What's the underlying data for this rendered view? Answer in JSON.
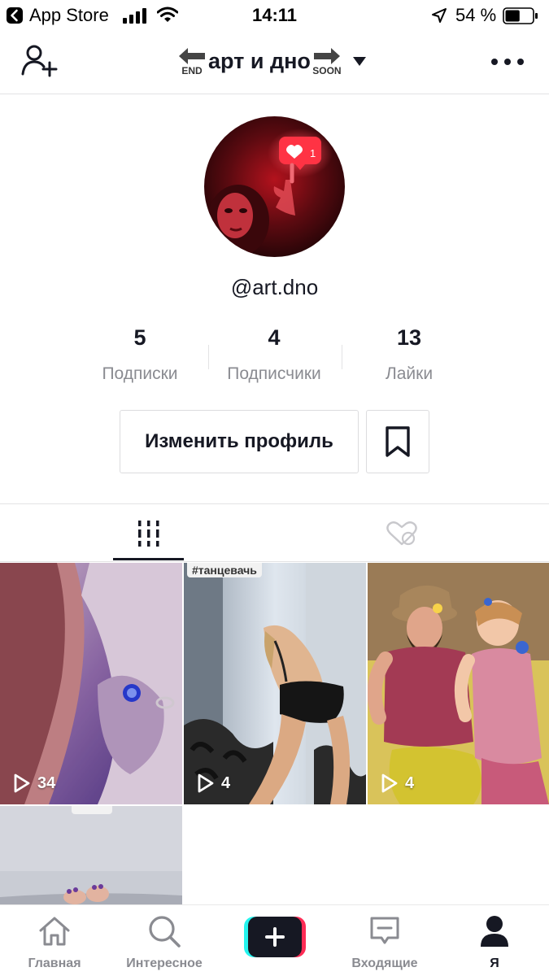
{
  "status_bar": {
    "back_app": "App Store",
    "time": "14:11",
    "battery_percent": "54 %",
    "battery_level": 0.54
  },
  "header": {
    "title": "арт и дно",
    "left_tag": "END",
    "right_tag": "SOON"
  },
  "profile": {
    "username": "@art.dno",
    "avatar_notification_count": "1",
    "stats": [
      {
        "value": "5",
        "label": "Подписки"
      },
      {
        "value": "4",
        "label": "Подписчики"
      },
      {
        "value": "13",
        "label": "Лайки"
      }
    ],
    "edit_button": "Изменить профиль"
  },
  "videos": [
    {
      "views": "34",
      "tag": ""
    },
    {
      "views": "4",
      "tag": "#танцевачь"
    },
    {
      "views": "4",
      "tag": ""
    },
    {
      "views": "",
      "tag": ""
    }
  ],
  "tab_bar": {
    "items": [
      {
        "label": "Главная",
        "icon": "home-icon"
      },
      {
        "label": "Интересное",
        "icon": "search-icon"
      },
      {
        "label": "",
        "icon": "plus-icon"
      },
      {
        "label": "Входящие",
        "icon": "inbox-icon"
      },
      {
        "label": "Я",
        "icon": "profile-icon"
      }
    ]
  },
  "colors": {
    "text": "#161823",
    "secondary": "#8a8b91",
    "cyan": "#25f4ee",
    "pink": "#fe2c55"
  }
}
